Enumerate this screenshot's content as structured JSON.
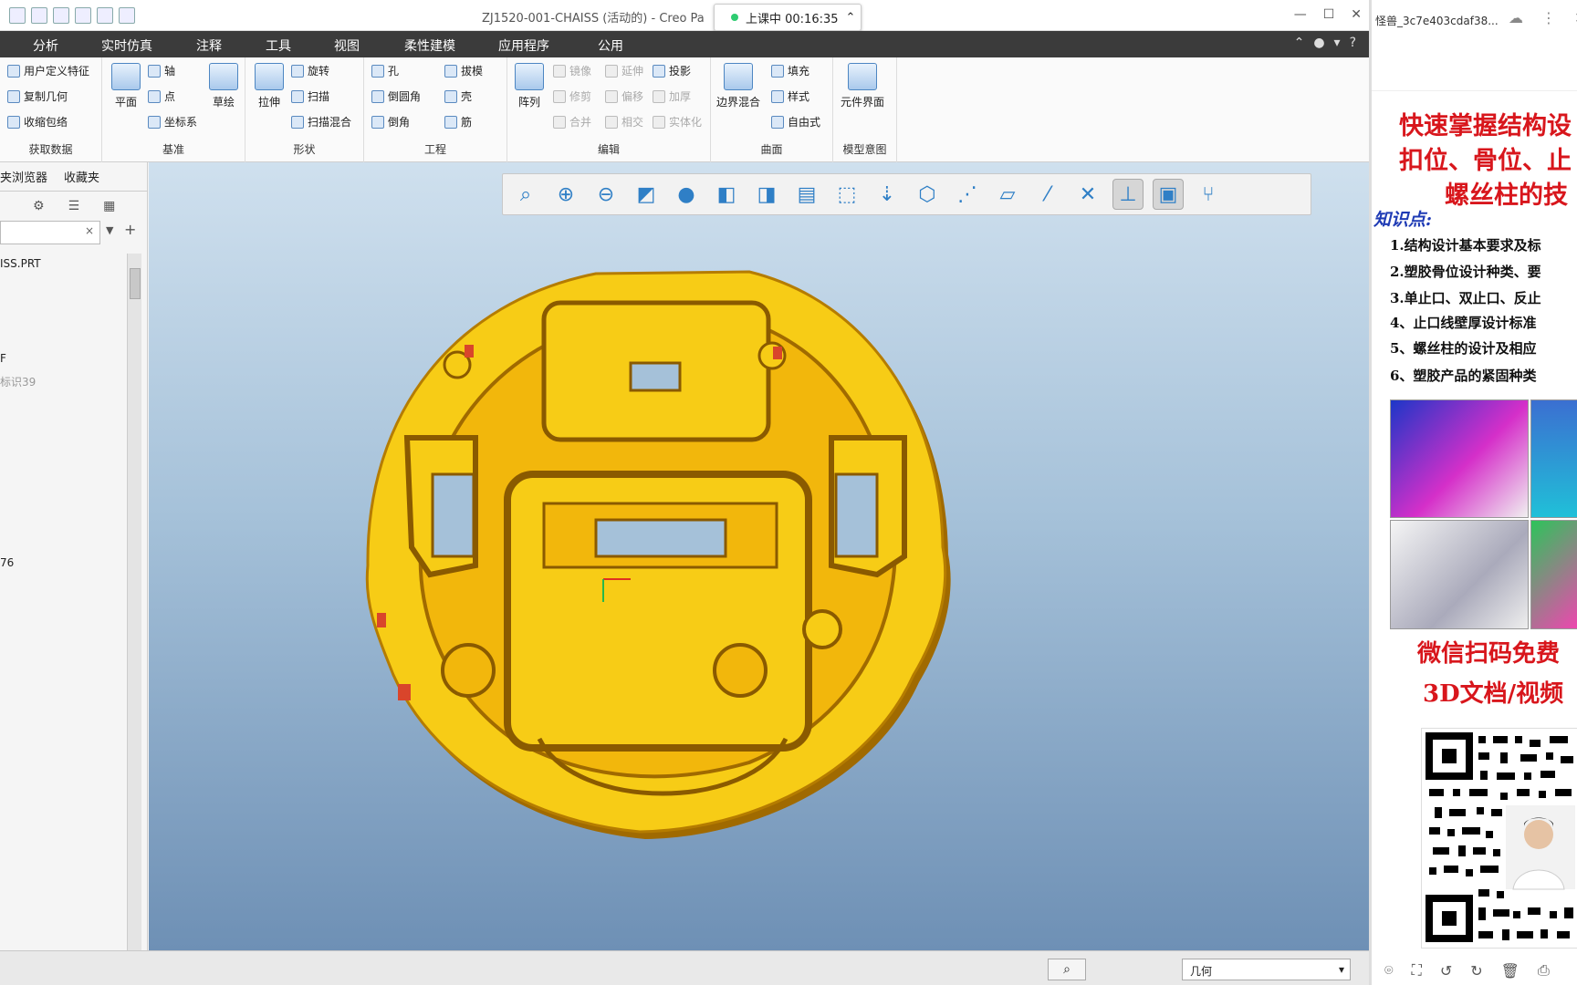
{
  "window": {
    "title": "ZJ1520-001-CHAISS (活动的) - Creo Pa",
    "live_badge": "上课中 00:16:35",
    "controls": [
      "—",
      "☐",
      "✕"
    ]
  },
  "menubar": {
    "tabs": [
      "分析",
      "实时仿真",
      "注释",
      "工具",
      "视图",
      "柔性建模",
      "应用程序",
      "公用"
    ]
  },
  "ribbon": {
    "get_data": {
      "items": [
        "用户定义特征",
        "复制几何",
        "收缩包络"
      ],
      "label": "获取数据"
    },
    "datum": {
      "plane": "平面",
      "axis": "轴",
      "point": "点",
      "csys": "坐标系",
      "sketch": "草绘",
      "label": "基准"
    },
    "shapes": {
      "extrude": "拉伸",
      "revolve": "旋转",
      "sweep": "扫描",
      "swept_blend": "扫描混合",
      "label": "形状"
    },
    "engineering": {
      "hole": "孔",
      "draft": "拔模",
      "round": "倒圆角",
      "shell": "壳",
      "chamfer": "倒角",
      "rib": "筋",
      "label": "工程"
    },
    "editing": {
      "pattern": "阵列",
      "mirror": "镜像",
      "extend": "延伸",
      "project": "投影",
      "trim": "修剪",
      "offset": "偏移",
      "thicken": "加厚",
      "merge": "合并",
      "intersect": "相交",
      "solidify": "实体化",
      "label": "编辑"
    },
    "surfaces": {
      "boundary_blend": "边界混合",
      "fill": "填充",
      "style": "样式",
      "freestyle": "自由式",
      "label": "曲面"
    },
    "model_intent": {
      "component_interface": "元件界面",
      "label": "模型意图"
    }
  },
  "panel": {
    "tabs": [
      "夹浏览器",
      "收藏夹"
    ],
    "tree": [
      "ISS.PRT",
      "F",
      "标识39",
      "76"
    ]
  },
  "viewport": {
    "toolbar_icons": [
      "refit-icon",
      "zoom-in-icon",
      "zoom-out-icon",
      "repaint-icon",
      "display-style-icon",
      "saved-views-icon",
      "view-manager-icon",
      "perspective-icon",
      "spin-center-icon",
      "annotation-display-icon",
      "plane-display-icon",
      "axis-display-icon",
      "point-display-icon",
      "csys-display-icon",
      "display-filter-icon",
      "model-tree-icon",
      "shading-icon",
      "section-icon"
    ],
    "colors": {
      "part": "#f7cc16",
      "part_shadow": "#a06a00",
      "bg_top": "#cfe0ee",
      "bg_bottom": "#6e90b5"
    }
  },
  "statusbar": {
    "filter_value": "几何",
    "binoculars": "⌕"
  },
  "right_panel": {
    "filename": "怪兽_3c7e403cdaf38...",
    "promo_lines": [
      "快速掌握结构设",
      "扣位、骨位、止",
      "螺丝柱的技"
    ],
    "knowledge_heading": "知识点:",
    "points": [
      "1.结构设计基本要求及标",
      "2.塑胶骨位设计种类、要",
      "3.单止口、双止口、反止",
      "4、止口线壁厚设计标准",
      "5、螺丝柱的设计及相应",
      "6、塑胶产品的紧固种类"
    ],
    "cta_lines": [
      "微信扫码免费",
      "3D文档/视频"
    ],
    "accent": "#d8161c"
  }
}
